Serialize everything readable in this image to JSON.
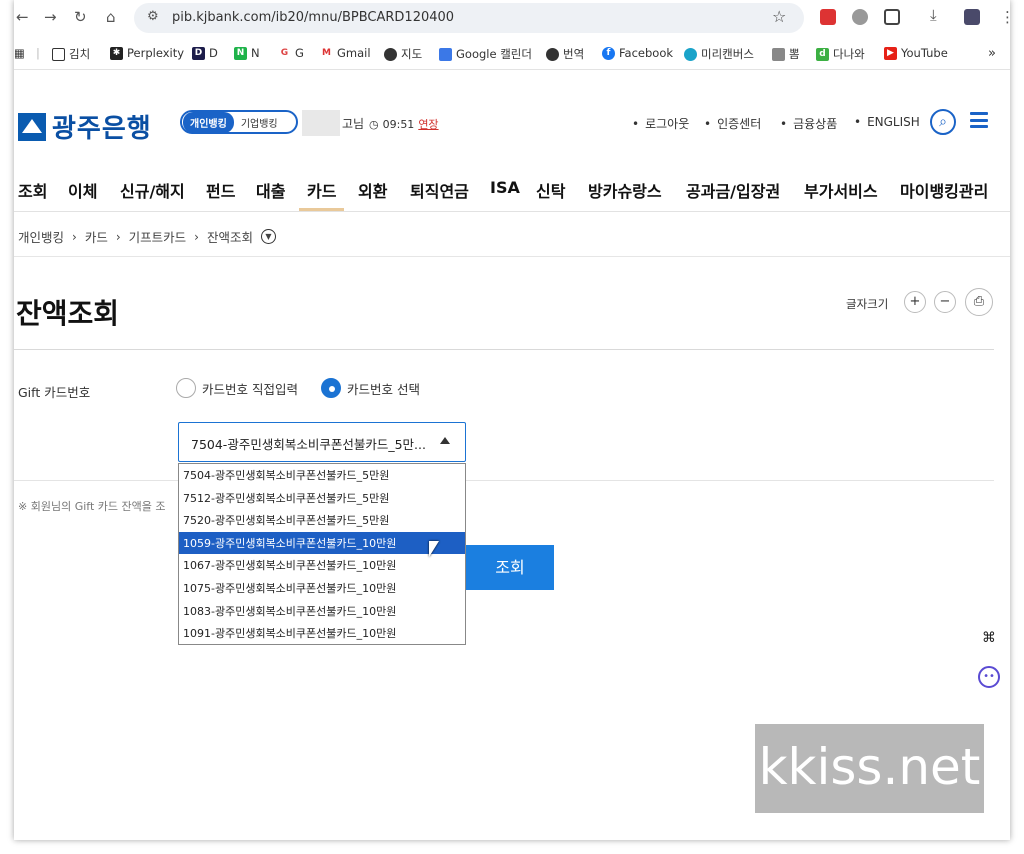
{
  "browser": {
    "url": "pib.kjbank.com/ib20/mnu/BPBCARD120400",
    "bookmarks": [
      {
        "label": "김치",
        "icon": "folder-icon"
      },
      {
        "label": "Perplexity",
        "icon": "perplexity-icon"
      },
      {
        "label": "D",
        "icon": "d-icon"
      },
      {
        "label": "N",
        "icon": "n-icon"
      },
      {
        "label": "G",
        "icon": "google-icon"
      },
      {
        "label": "Gmail",
        "icon": "gmail-icon"
      },
      {
        "label": "지도",
        "icon": "map-icon"
      },
      {
        "label": "Google 캘린더",
        "icon": "calendar-icon"
      },
      {
        "label": "번역",
        "icon": "translate-icon"
      },
      {
        "label": "Facebook",
        "icon": "facebook-icon"
      },
      {
        "label": "미리캔버스",
        "icon": "miricanvas-icon"
      },
      {
        "label": "뽐",
        "icon": "ppom-icon"
      },
      {
        "label": "다나와",
        "icon": "danawa-icon"
      },
      {
        "label": "YouTube",
        "icon": "youtube-icon"
      }
    ],
    "more": "»"
  },
  "header": {
    "logo": "광주은행",
    "seg_personal": "개인뱅킹",
    "seg_corporate": "기업뱅킹",
    "name_suffix": "고님",
    "time": "09:51",
    "extend": "연장",
    "util": [
      "로그아웃",
      "인증센터",
      "금융상품",
      "ENGLISH"
    ]
  },
  "gnb": [
    "조회",
    "이체",
    "신규/해지",
    "펀드",
    "대출",
    "카드",
    "외환",
    "퇴직연금",
    "ISA",
    "신탁",
    "방카슈랑스",
    "공과금/입장권",
    "부가서비스",
    "마이뱅킹관리"
  ],
  "breadcrumb": [
    "개인뱅킹",
    "카드",
    "기프트카드",
    "잔액조회"
  ],
  "page": {
    "title": "잔액조회",
    "font_size_label": "글자크기",
    "plus": "+",
    "minus": "−"
  },
  "form": {
    "card_label": "Gift 카드번호",
    "radio_direct": "카드번호 직접입력",
    "radio_select": "카드번호 선택",
    "selected_value": "7504-광주민생회복소비쿠폰선불카드_5만...",
    "options": [
      "7504-광주민생회복소비쿠폰선불카드_5만원",
      "7512-광주민생회복소비쿠폰선불카드_5만원",
      "7520-광주민생회복소비쿠폰선불카드_5만원",
      "1059-광주민생회복소비쿠폰선불카드_10만원",
      "1067-광주민생회복소비쿠폰선불카드_10만원",
      "1075-광주민생회복소비쿠폰선불카드_10만원",
      "1083-광주민생회복소비쿠폰선불카드_10만원",
      "1091-광주민생회복소비쿠폰선불카드_10만원"
    ],
    "highlighted_index": 3,
    "notice": "※ 회원님의 Gift 카드 잔액을 조",
    "query_button": "조회"
  },
  "watermark": "kkiss.net"
}
